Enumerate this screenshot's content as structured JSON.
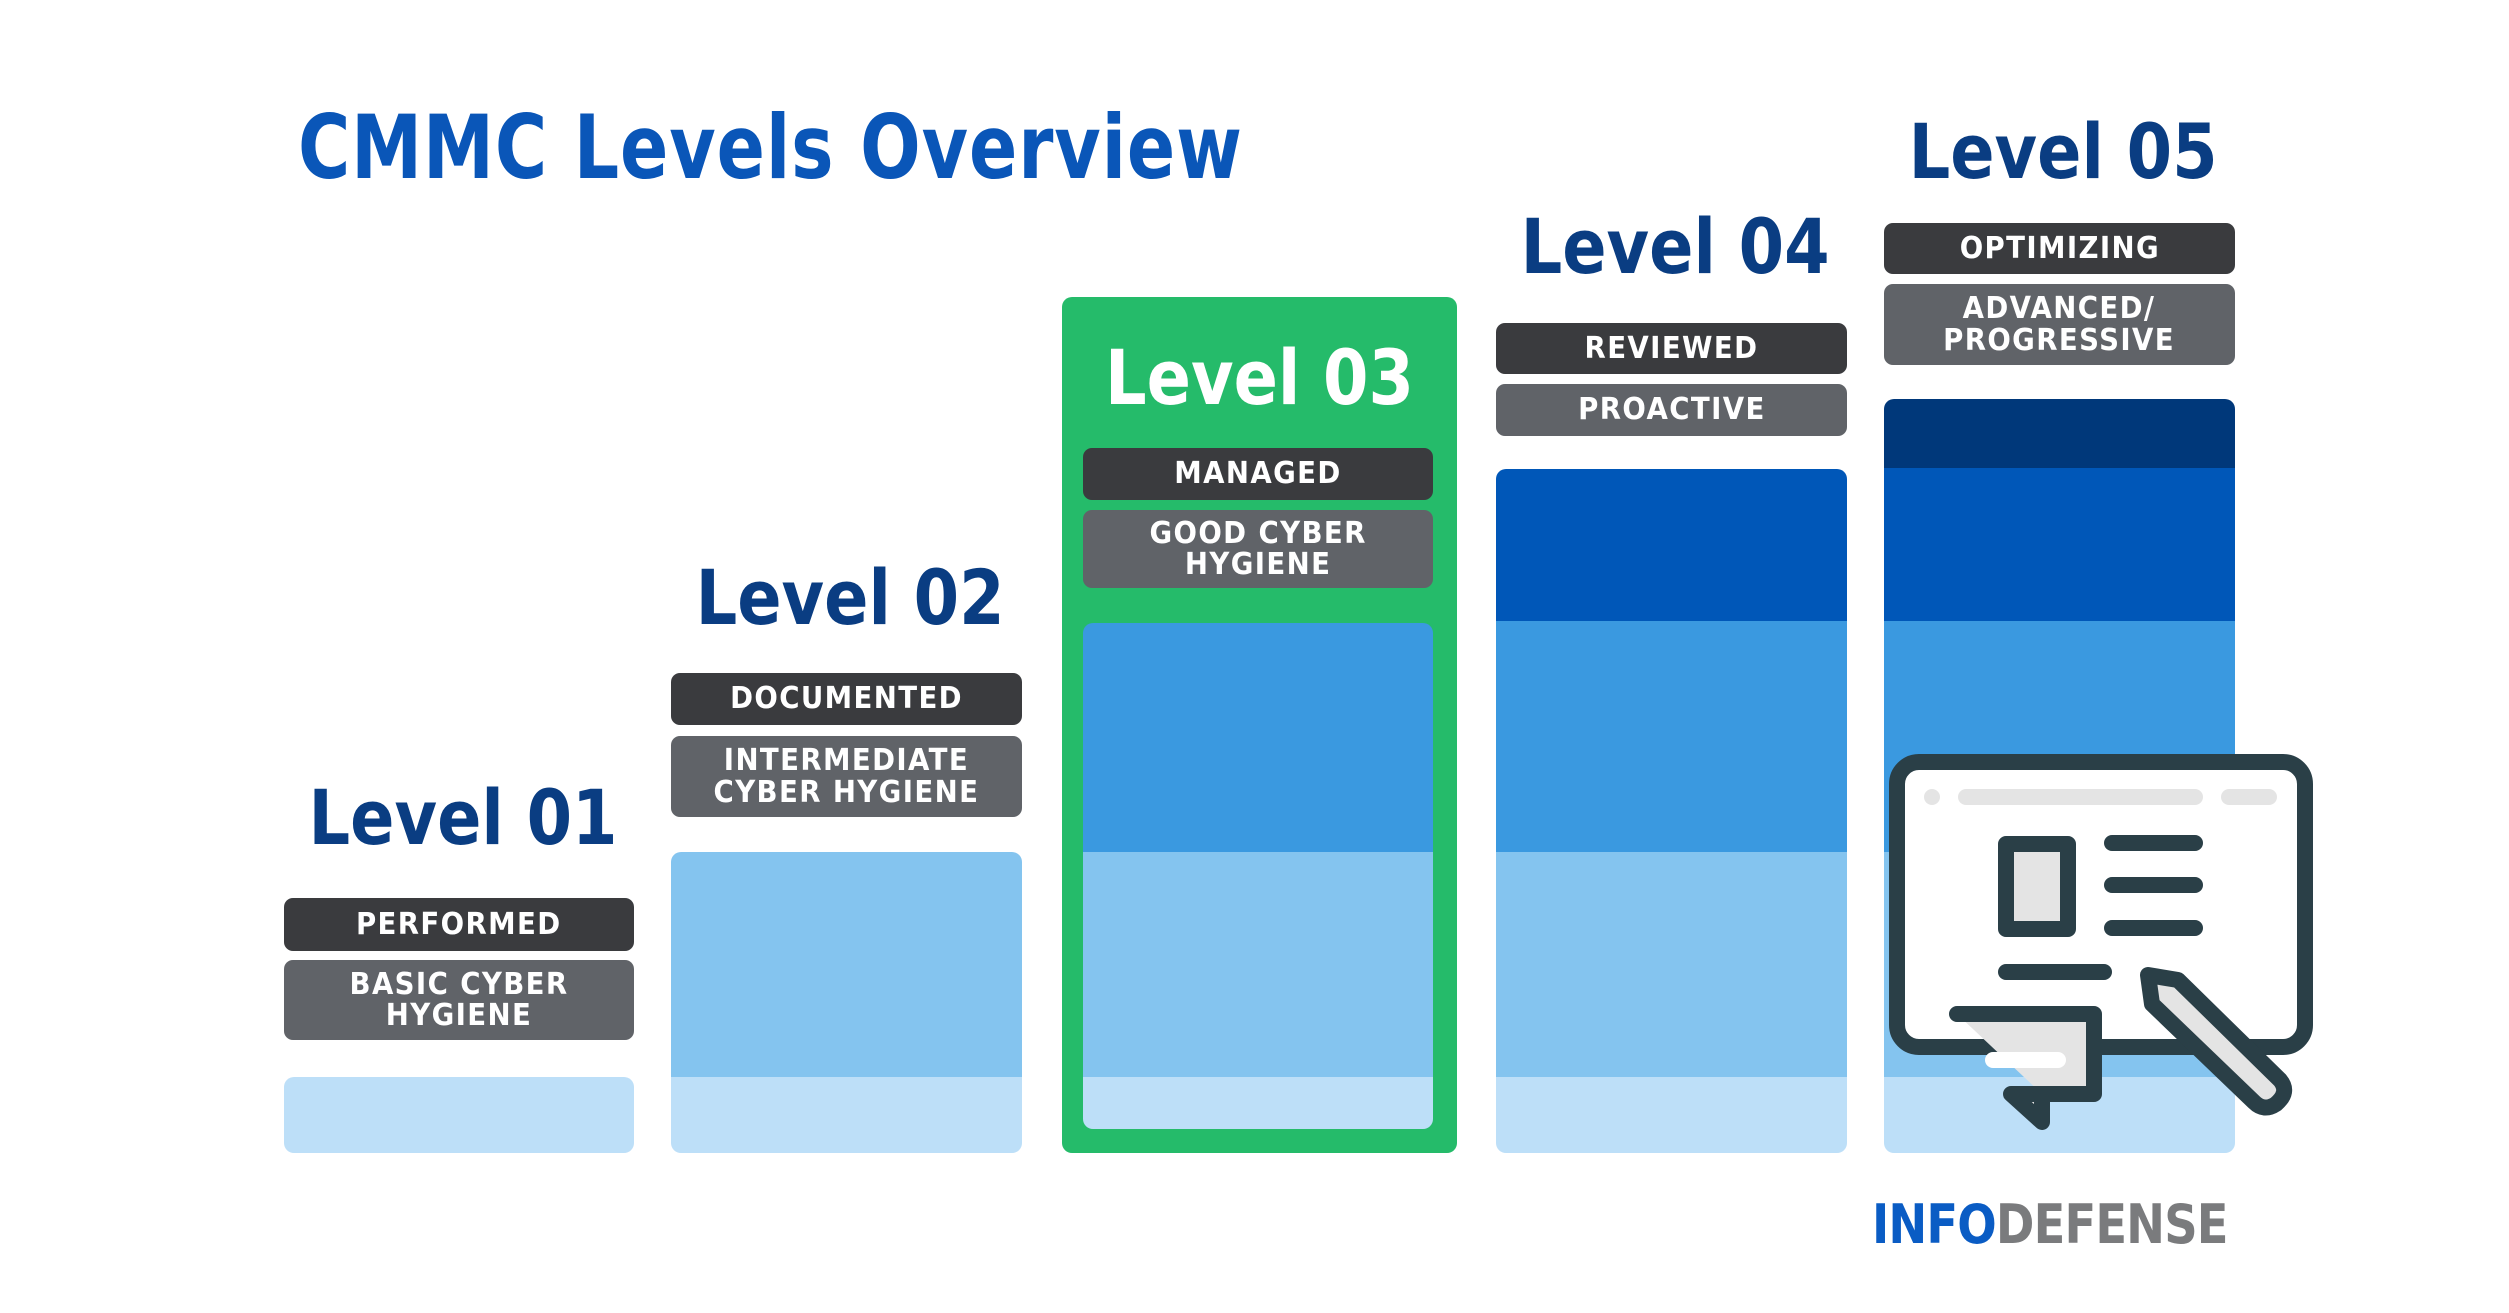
{
  "title": "CMMC Levels Overview",
  "colors": {
    "title": "#0a56b8",
    "level_title": "#0a3d82",
    "highlight": "#25bb6a",
    "pill_dark": "#3a3b3e",
    "pill_gray": "#606368",
    "tier_colors": [
      "#bddff8",
      "#84c4ef",
      "#3a99e0",
      "#0057b8",
      "#00387a"
    ]
  },
  "levels": [
    {
      "name": "Level 01",
      "process": "PERFORMED",
      "practice": "BASIC CYBER\nHYGIENE",
      "tiers": 1,
      "highlighted": false
    },
    {
      "name": "Level 02",
      "process": "DOCUMENTED",
      "practice": "INTERMEDIATE\nCYBER HYGIENE",
      "tiers": 2,
      "highlighted": false
    },
    {
      "name": "Level 03",
      "process": "MANAGED",
      "practice": "GOOD CYBER\nHYGIENE",
      "tiers": 3,
      "highlighted": true
    },
    {
      "name": "Level 04",
      "process": "REVIEWED",
      "practice": "PROACTIVE",
      "tiers": 4,
      "highlighted": false
    },
    {
      "name": "Level 05",
      "process": "OPTIMIZING",
      "practice": "ADVANCED/\nPROGRESSIVE",
      "tiers": 5,
      "highlighted": false
    }
  ],
  "icon": "presentation-board-icon",
  "logo": {
    "part1": "INFO",
    "part2": "DEFENSE"
  }
}
